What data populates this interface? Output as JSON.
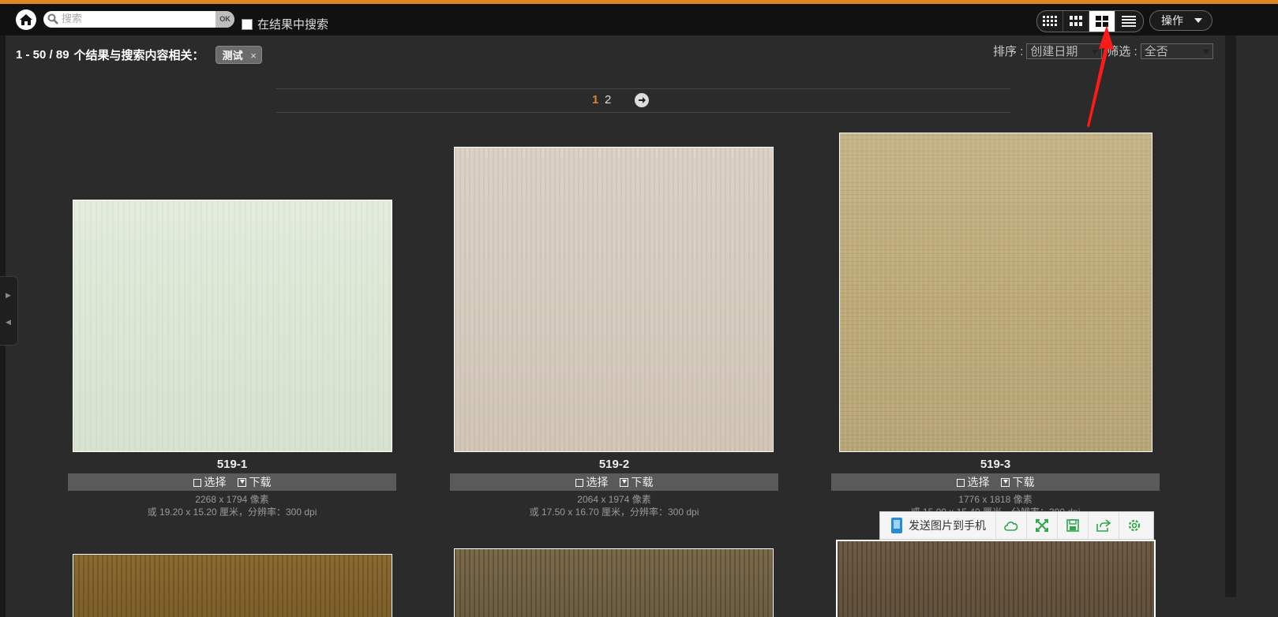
{
  "search": {
    "placeholder": "搜索",
    "ok_label": "OK",
    "in_results_label": "在结果中搜索"
  },
  "view_modes": [
    "small-grid",
    "medium-grid",
    "large-grid",
    "list"
  ],
  "active_view": "large-grid",
  "actions_label": "操作",
  "summary": {
    "range": "1 - 50 / 89",
    "text": "个结果与搜索内容相关：",
    "tag": "测试",
    "tag_remove": "×"
  },
  "sort": {
    "label": "排序 :",
    "value": "创建日期",
    "filter_label": "筛选 :",
    "filter_value": "全否"
  },
  "pagination": {
    "current": "1",
    "other": "2"
  },
  "cards": [
    {
      "title": "519-1",
      "select_label": "选择",
      "download_label": "下载",
      "pixels": "2268 x 1794 像素",
      "size": "或 19.20 x 15.20 厘米，分辨率：300 dpi"
    },
    {
      "title": "519-2",
      "select_label": "选择",
      "download_label": "下载",
      "pixels": "2064 x 1974 像素",
      "size": "或 17.50 x 16.70 厘米，分辨率：300 dpi"
    },
    {
      "title": "519-3",
      "select_label": "选择",
      "download_label": "下载",
      "pixels": "1776 x 1818 像素",
      "size": "或 15.00 x 15.40 厘米，分辨率：300 dpi"
    }
  ],
  "floating_toolbar": {
    "send_label": "发送图片到手机",
    "icons": [
      "cloud-icon",
      "fullscreen-icon",
      "save-icon",
      "share-icon",
      "settings-icon"
    ]
  },
  "colors": {
    "accent": "#e0841f",
    "annotation_arrow": "#ff1a1a"
  }
}
